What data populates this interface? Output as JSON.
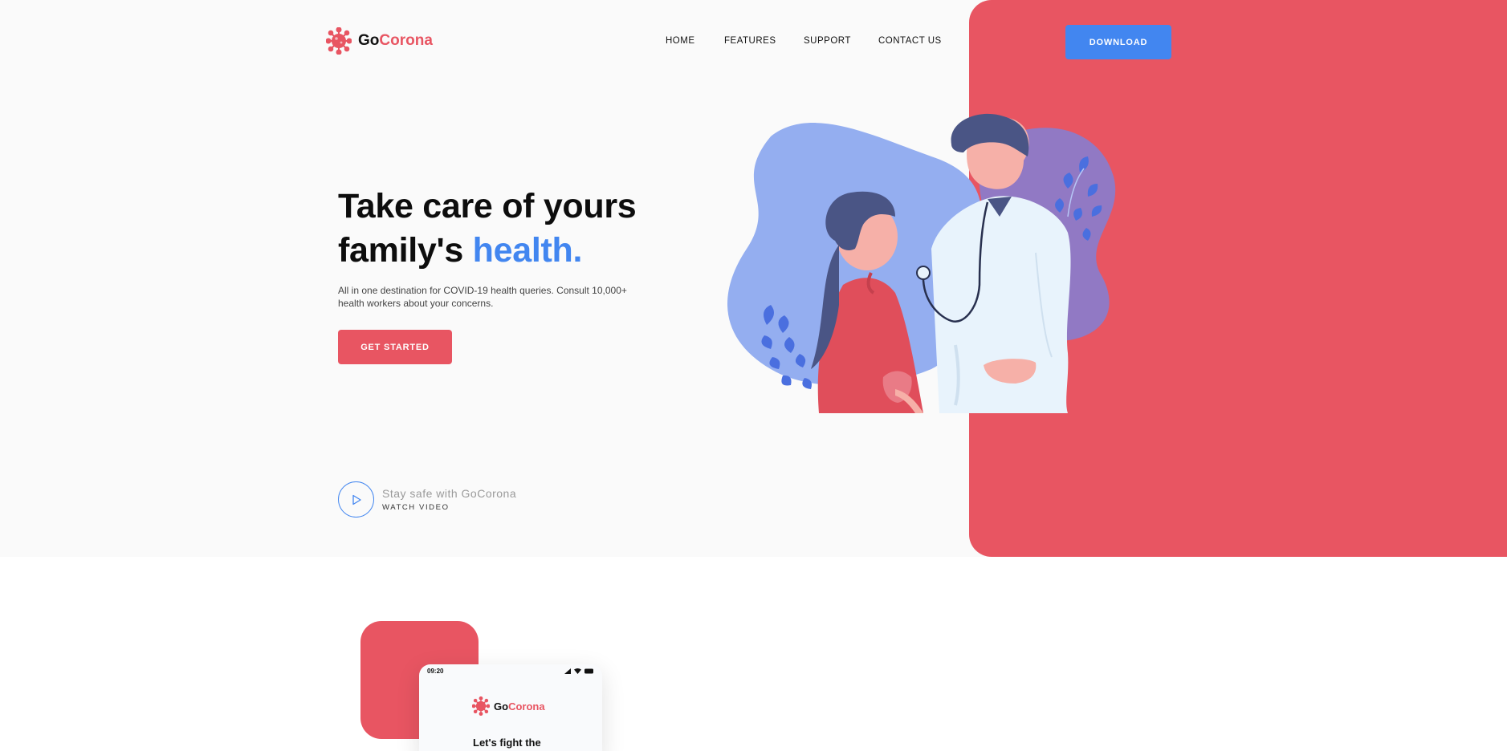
{
  "brand": {
    "name_part1": "Go",
    "name_part2": "Corona",
    "accent": "#e85562",
    "blue": "#4286f0"
  },
  "nav": {
    "items": [
      "HOME",
      "FEATURES",
      "SUPPORT",
      "CONTACT US"
    ],
    "download_label": "DOWNLOAD"
  },
  "hero": {
    "headline_line1": "Take care of yours",
    "headline_line2_a": "family's ",
    "headline_line2_b": "health.",
    "subtext": "All in one destination for COVID-19 health queries. Consult 10,000+ health workers about your concerns.",
    "cta_label": "GET STARTED",
    "video_title": "Stay safe with GoCorona",
    "video_sub": "WATCH VIDEO",
    "icons": {
      "logo": "virus-logo-icon",
      "play": "play-icon"
    }
  },
  "phone": {
    "time": "09:20",
    "brand_part1": "Go",
    "brand_part2": "Corona",
    "heading": "Let's fight the",
    "icons": [
      "signal-icon",
      "wifi-icon",
      "battery-icon"
    ]
  }
}
